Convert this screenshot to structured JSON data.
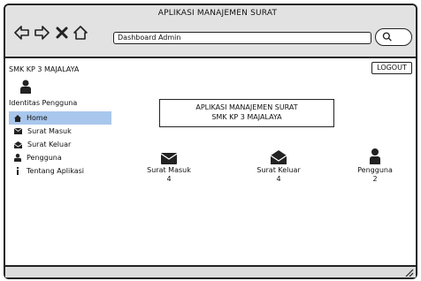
{
  "window": {
    "title": "APLIKASI MANAJEMEN SURAT"
  },
  "browser": {
    "address": "Dashboard Admin",
    "icons": [
      "back-arrow-icon",
      "forward-arrow-icon",
      "close-icon",
      "home-icon",
      "search-icon"
    ]
  },
  "header": {
    "school": "SMK KP 3 MAJALAYA",
    "logout_label": "LOGOUT"
  },
  "sidebar": {
    "identity_label": "Identitas Pengguna",
    "items": [
      {
        "label": "Home",
        "icon": "home-icon",
        "active": true
      },
      {
        "label": "Surat Masuk",
        "icon": "envelope-icon",
        "active": false
      },
      {
        "label": "Surat Keluar",
        "icon": "open-envelope-icon",
        "active": false
      },
      {
        "label": "Pengguna",
        "icon": "user-icon",
        "active": false
      },
      {
        "label": "Tentang Aplikasi",
        "icon": "info-icon",
        "active": false
      }
    ]
  },
  "main": {
    "banner_line1": "APLIKASI MANAJEMEN SURAT",
    "banner_line2": "SMK KP 3 MAJALAYA",
    "stats": [
      {
        "label": "Surat Masuk",
        "value": "4",
        "icon": "envelope-icon"
      },
      {
        "label": "Surat Keluar",
        "value": "4",
        "icon": "open-envelope-icon"
      },
      {
        "label": "Pengguna",
        "value": "2",
        "icon": "user-icon"
      }
    ]
  },
  "colors": {
    "active_bg": "#a9c7ec",
    "chrome": "#e2e2e2"
  }
}
